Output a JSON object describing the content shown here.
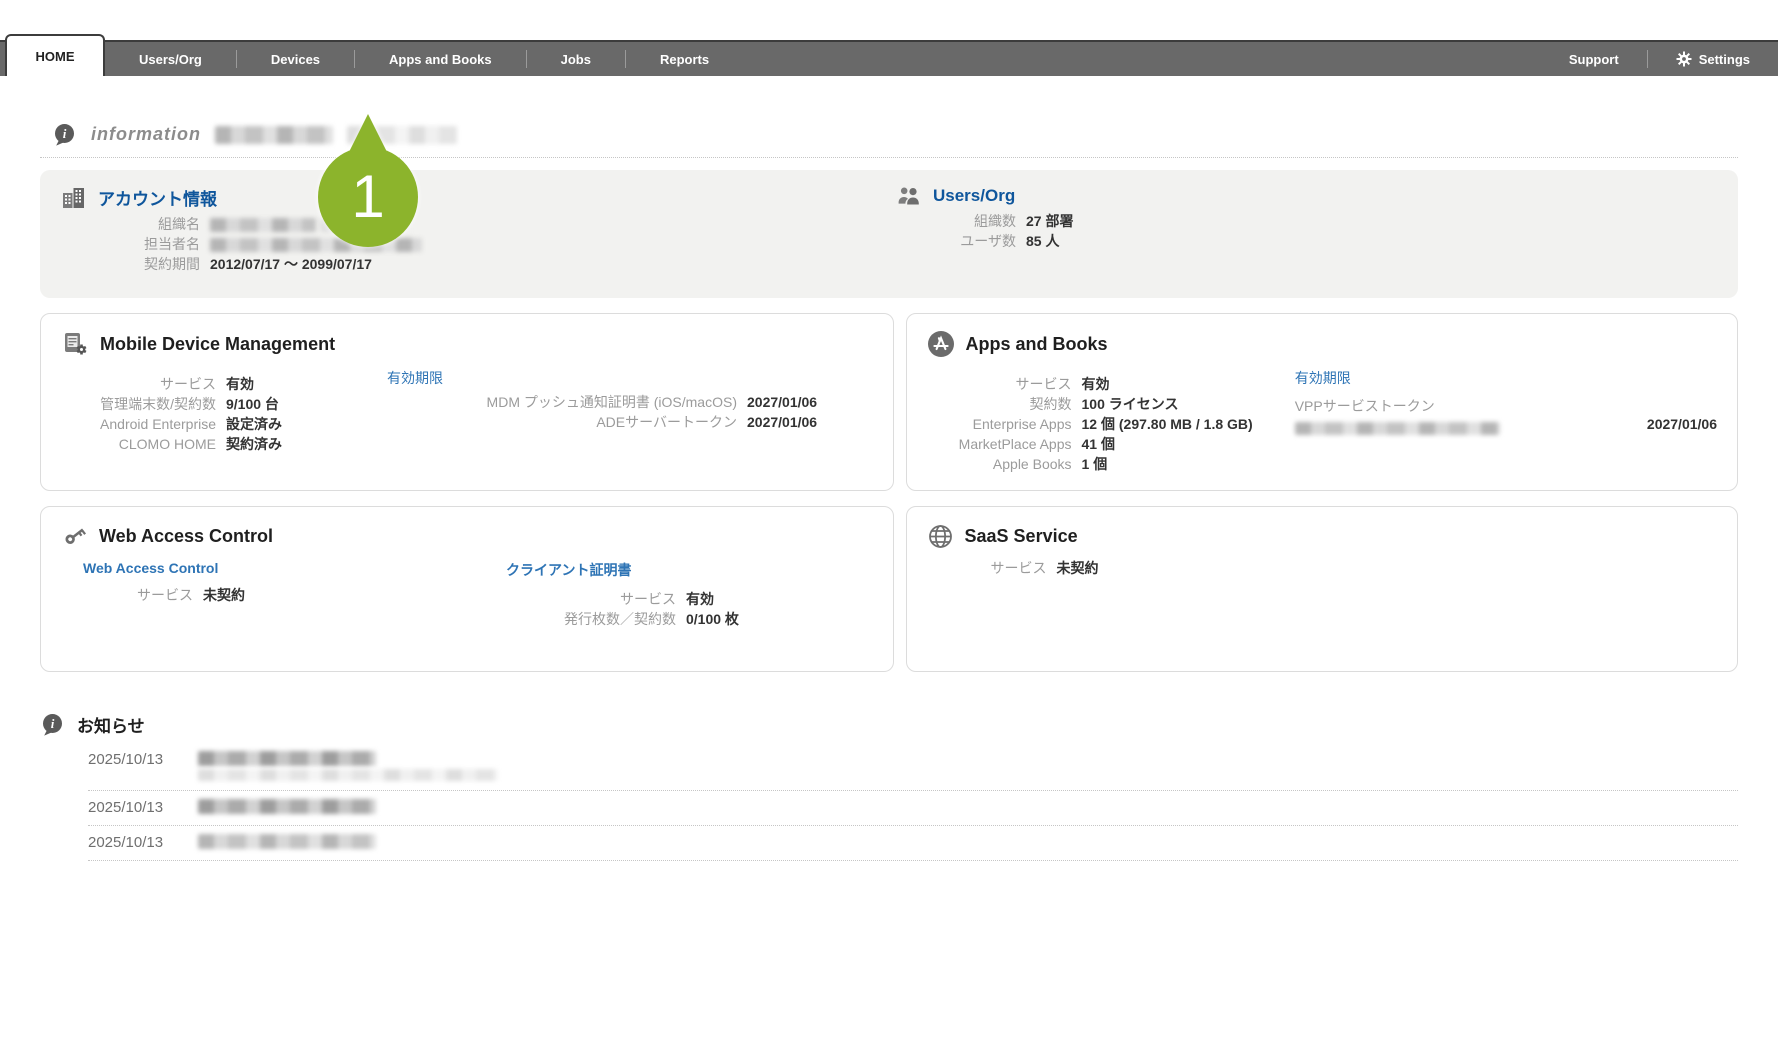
{
  "nav": {
    "active_tab": "HOME",
    "tabs": [
      "Users/Org",
      "Devices",
      "Apps and Books",
      "Jobs",
      "Reports"
    ],
    "support": "Support",
    "settings": "Settings"
  },
  "callout": {
    "number": "1",
    "color": "#8cb42c",
    "points_to": "Apps and Books"
  },
  "info_header": {
    "title": "information"
  },
  "account": {
    "title": "アカウント情報",
    "org_label": "組織名",
    "contact_label": "担当者名",
    "period_label": "契約期間",
    "period_value": "2012/07/17 ～ 2099/07/17"
  },
  "users_org": {
    "title": "Users/Org",
    "rows": [
      {
        "label": "組織数",
        "value": "27 部署"
      },
      {
        "label": "ユーザ数",
        "value": "85 人"
      }
    ]
  },
  "mdm": {
    "title": "Mobile Device Management",
    "rows": [
      {
        "label": "サービス",
        "value": "有効"
      },
      {
        "label": "管理端末数/契約数",
        "value": "9/100 台"
      },
      {
        "label": "Android Enterprise",
        "value": "設定済み"
      },
      {
        "label": "CLOMO HOME",
        "value": "契約済み"
      }
    ],
    "expiry_link": "有効期限",
    "expiry_rows": [
      {
        "label": "MDM プッシュ通知証明書 (iOS/macOS)",
        "value": "2027/01/06"
      },
      {
        "label": "ADEサーバートークン",
        "value": "2027/01/06"
      }
    ]
  },
  "apps_books": {
    "title": "Apps and Books",
    "rows": [
      {
        "label": "サービス",
        "value": "有効"
      },
      {
        "label": "契約数",
        "value": "100 ライセンス"
      },
      {
        "label": "Enterprise Apps",
        "value": "12 個 (297.80 MB / 1.8 GB)"
      },
      {
        "label": "MarketPlace Apps",
        "value": "41 個"
      },
      {
        "label": "Apple Books",
        "value": "1 個"
      }
    ],
    "expiry_link": "有効期限",
    "token_label": "VPPサービストークン",
    "token_expiry": "2027/01/06"
  },
  "wac": {
    "title": "Web Access Control",
    "left_link": "Web Access Control",
    "left_rows": [
      {
        "label": "サービス",
        "value": "未契約"
      }
    ],
    "right_link": "クライアント証明書",
    "right_rows": [
      {
        "label": "サービス",
        "value": "有効"
      },
      {
        "label": "発行枚数／契約数",
        "value": "0/100 枚"
      }
    ]
  },
  "saas": {
    "title": "SaaS Service",
    "rows": [
      {
        "label": "サービス",
        "value": "未契約"
      }
    ]
  },
  "news": {
    "title": "お知らせ",
    "items": [
      {
        "date": "2025/10/13"
      },
      {
        "date": "2025/10/13"
      },
      {
        "date": "2025/10/13"
      }
    ]
  },
  "colors": {
    "accent_green": "#8cb42c",
    "nav_gray": "#696969",
    "link_blue": "#2e74b5",
    "header_blue": "#0f569c"
  }
}
